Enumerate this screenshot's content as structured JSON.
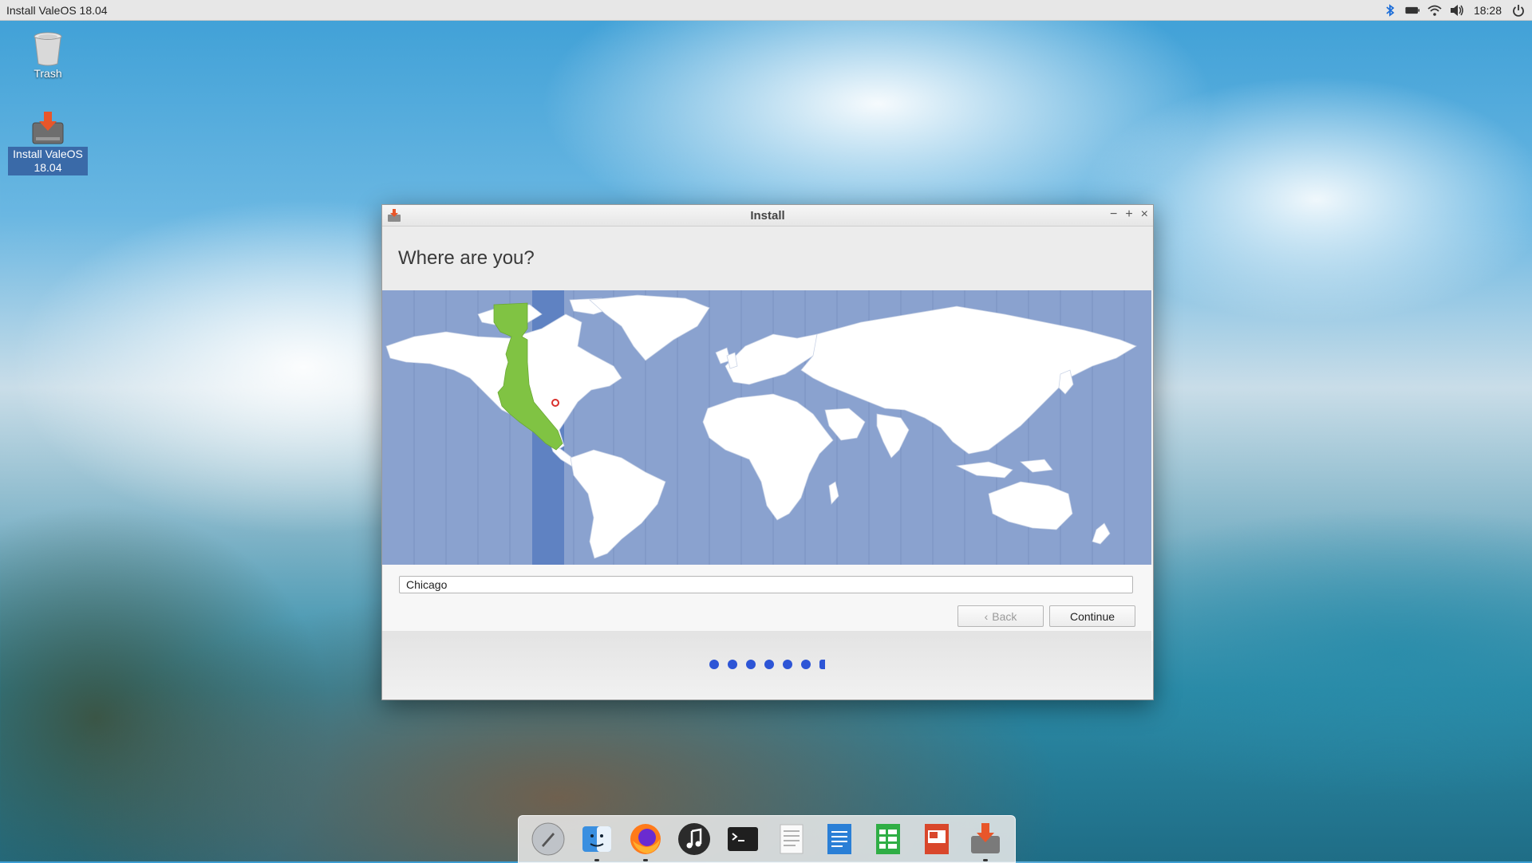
{
  "top_panel": {
    "app_title": "Install ValeOS 18.04",
    "clock": "18:28",
    "tray_icons": [
      "bluetooth-icon",
      "battery-icon",
      "wifi-icon",
      "volume-icon",
      "power-icon"
    ]
  },
  "desktop": {
    "icons": [
      {
        "label": "Trash",
        "icon": "trash-icon"
      },
      {
        "label_line1": "Install ValeOS",
        "label_line2": "18.04",
        "icon": "installer-icon"
      }
    ]
  },
  "window": {
    "title": "Install",
    "heading": "Where are you?",
    "map": {
      "selected_timezone_region": "America/Chicago",
      "marker_city": "Chicago",
      "colors": {
        "ocean": "#8aa2cf",
        "land": "#ffffff",
        "selected_zone": "#80c343",
        "zone_band": "#5f82c2"
      }
    },
    "location_field": {
      "value": "Chicago"
    },
    "buttons": {
      "back": "Back",
      "continue": "Continue"
    },
    "progress": {
      "total_steps": 7,
      "completed_steps": 6
    }
  },
  "dock": {
    "apps": [
      "launchpad-icon",
      "finder-icon",
      "firefox-icon",
      "music-icon",
      "terminal-icon",
      "text-editor-icon",
      "writer-icon",
      "calc-icon",
      "impress-icon",
      "installer-icon"
    ]
  },
  "colors": {
    "accent": "#2d55d6",
    "selection": "#3a6aa8"
  }
}
